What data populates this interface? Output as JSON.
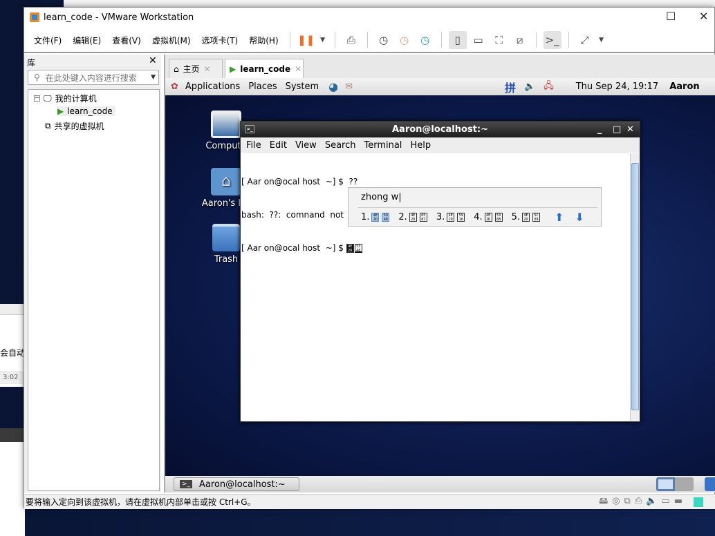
{
  "window": {
    "title": "learn_code - VMware Workstation"
  },
  "menu": [
    "文件(F)",
    "编辑(E)",
    "查看(V)",
    "虚拟机(M)",
    "选项卡(T)",
    "帮助(H)"
  ],
  "library": {
    "title": "库",
    "search_placeholder": "在此处键入内容进行搜索",
    "tree": {
      "my_computer": "我的计算机",
      "vm": "learn_code",
      "shared": "共享的虚拟机"
    }
  },
  "tabs": [
    {
      "label": "主页"
    },
    {
      "label": "learn_code"
    }
  ],
  "guest_panel": {
    "menus": [
      "Applications",
      "Places",
      "System"
    ],
    "clock": "Thu Sep 24, 19:17",
    "user": "Aaron",
    "ime_icon": "拼"
  },
  "desktop_icons": [
    "Compute",
    "Aaron's Ho",
    "Trash"
  ],
  "terminal": {
    "title": "Aaron@localhost:~",
    "menu": [
      "File",
      "Edit",
      "View",
      "Search",
      "Terminal",
      "Help"
    ],
    "lines": [
      "[ Aar on@ocal host  ~] $  ??",
      "bash:  ??:  comnand  not  f ound",
      "[ Aar on@ocal host  ~] $ "
    ],
    "input_codes": [
      [
        "4E",
        "2D"
      ],
      [
        "53",
        "48"
      ]
    ]
  },
  "ime": {
    "preedit": "zhong w|",
    "candidates": [
      {
        "num": "1.",
        "codes": [
          [
            "4E",
            "2D"
          ],
          [
            "53",
            "48"
          ]
        ]
      },
      {
        "num": "2.",
        "codes": [
          [
            "4E",
            "2D"
          ],
          [
            "65",
            "87"
          ]
        ]
      },
      {
        "num": "3.",
        "codes": [
          [
            "4E",
            "2D"
          ],
          [
            "59",
            "16"
          ]
        ]
      },
      {
        "num": "4.",
        "codes": [
          [
            "4E",
            "2D"
          ],
          [
            "53",
            "6B"
          ]
        ]
      },
      {
        "num": "5.",
        "codes": [
          [
            "4E",
            "2D"
          ],
          [
            "5C",
            "09"
          ]
        ]
      }
    ]
  },
  "taskbar": {
    "item": "Aaron@localhost:~"
  },
  "statusbar": {
    "message": "要将输入定向到该虚拟机，请在虚拟机内部单击或按 Ctrl+G。"
  },
  "behind": {
    "text1": "会自动",
    "text2": "3:02"
  },
  "colors": {
    "accent": "#e9702a",
    "selection": "#a9c7ea"
  }
}
